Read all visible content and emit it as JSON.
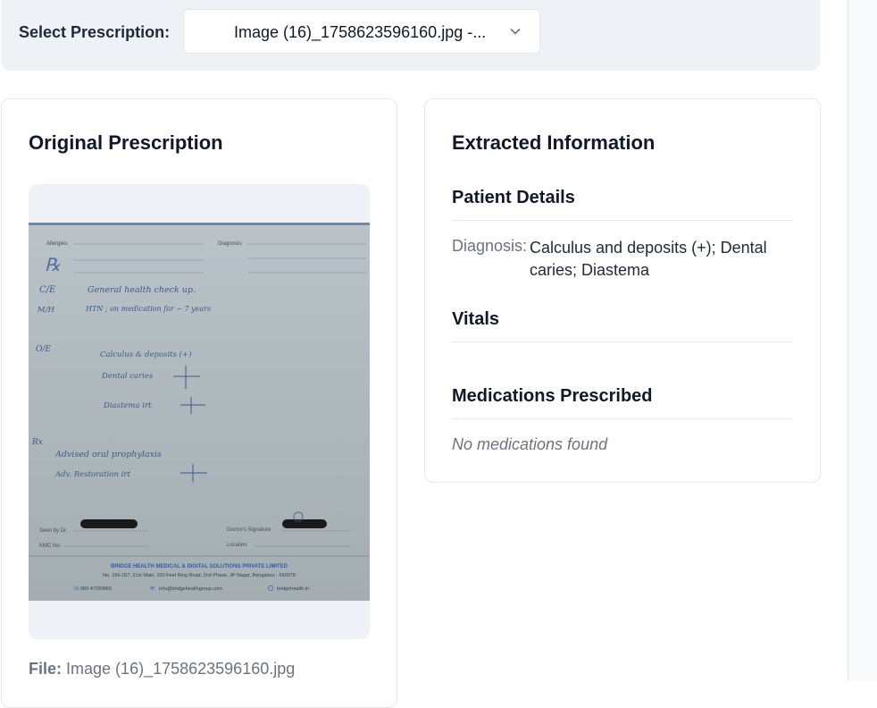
{
  "selector": {
    "label": "Select Prescription:",
    "selected_value": "Image (16)_1758623596160.jpg -..."
  },
  "original": {
    "title": "Original Prescription",
    "file_label": "File:",
    "file_name": "Image (16)_1758623596160.jpg",
    "image": {
      "form_labels": {
        "allergies": "Allergies:",
        "diagnosis": "Diagnosis:",
        "seen_by": "Seen by Dr.",
        "kmc_no": "KMC No.",
        "doctor_signature": "Doctor's Signature",
        "location": "Location"
      },
      "handwriting": {
        "rx_symbol": "℞",
        "c_e_label": "C/E",
        "c_e_text": "General health check up.",
        "m_h_label": "M/H",
        "m_h_text": "HTN ; on medication for ~ 7 years",
        "o_e_label": "O/E",
        "finding_1": "Calculus & deposits (+)",
        "finding_2": "Dental caries",
        "finding_3": "Diastema irt",
        "rx_label": "Rx",
        "advice_1": "Advised oral prophylaxis",
        "advice_2": "Adv. Restoration irt"
      },
      "footer": {
        "company": "BRIDGE HEALTH MEDICAL & DIGITAL SOLUTIONS PRIVATE LIMITED",
        "address": "No. 166-167, 21st Main, 100 Feet Ring Road, 2nd Phase, JP Nagar, Bengaluru - 560078",
        "phone": "080 47093866",
        "email": "info@bridgehealthgroup.com",
        "web": "bridgehealth.in"
      }
    }
  },
  "extracted": {
    "title": "Extracted Information",
    "patient_details_title": "Patient Details",
    "diagnosis_label": "Diagnosis:",
    "diagnosis_value": "Calculus and deposits (+); Dental caries; Diastema",
    "vitals_title": "Vitals",
    "medications_title": "Medications Prescribed",
    "no_medications": "No medications found"
  },
  "colors": {
    "topbar_bg": "#eef2f7",
    "muted_text": "#6b7280",
    "border": "#e5e7eb",
    "ink": "#3d5a8a",
    "footer_blue": "#2d5ea8"
  },
  "icons": {
    "select_chevron": "chevron-down-icon",
    "phone": "phone-icon",
    "email": "mail-icon",
    "web": "globe-icon"
  }
}
